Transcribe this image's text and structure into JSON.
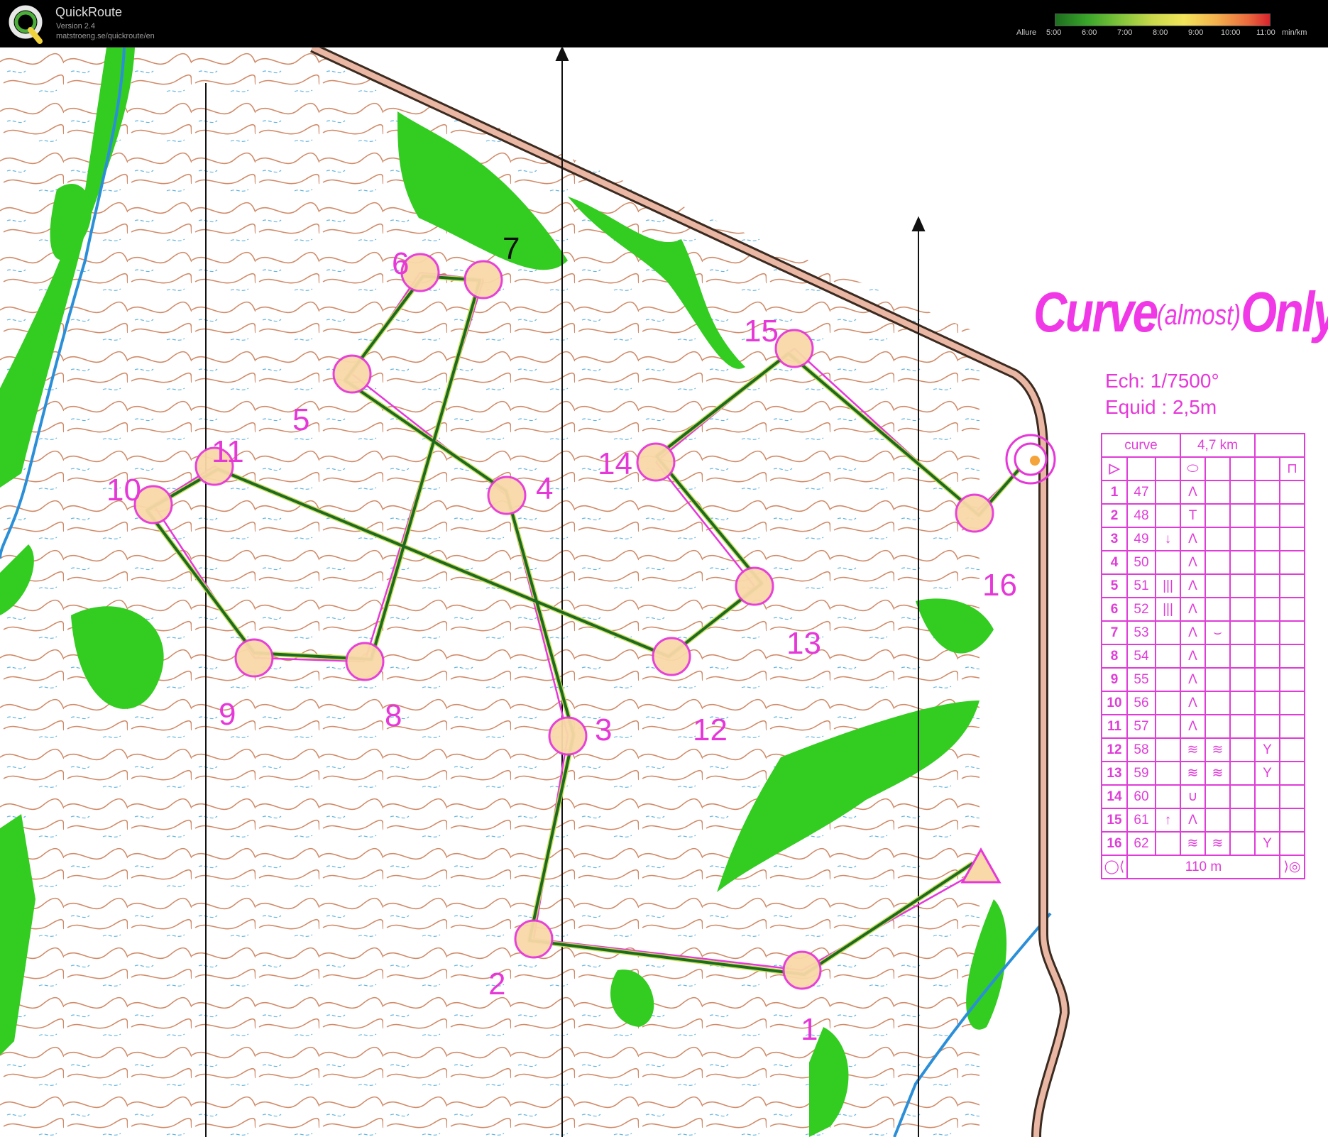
{
  "app": {
    "name": "QuickRoute",
    "version": "Version 2.4",
    "url": "matstroeng.se/quickroute/en"
  },
  "pace_scale": {
    "label": "Allure",
    "unit": "min/km",
    "ticks": [
      "5:00",
      "6:00",
      "7:00",
      "8:00",
      "9:00",
      "10:00",
      "11:00"
    ],
    "colors": [
      "#1d6e1f",
      "#3aa52a",
      "#7fc43a",
      "#c8d84a",
      "#f2e45a",
      "#f4b14d",
      "#ea6a3d",
      "#d8232c"
    ]
  },
  "map": {
    "title_main_1": "Curve",
    "title_small": "(almost)",
    "title_main_2": "Only",
    "scale_text": "Ech: 1/7500°",
    "equidistance_text": "Equid : 2,5m",
    "route_color": "#1f6a21",
    "course_color": "#e637d8",
    "controls": [
      {
        "label": "1"
      },
      {
        "label": "2"
      },
      {
        "label": "3"
      },
      {
        "label": "4"
      },
      {
        "label": "5"
      },
      {
        "label": "6"
      },
      {
        "label": "7"
      },
      {
        "label": "8"
      },
      {
        "label": "9"
      },
      {
        "label": "10"
      },
      {
        "label": "11"
      },
      {
        "label": "12"
      },
      {
        "label": "13"
      },
      {
        "label": "14"
      },
      {
        "label": "15"
      },
      {
        "label": "16"
      }
    ]
  },
  "description_sheet": {
    "class_name": "curve",
    "length": "4,7 km",
    "finish_distance": "110 m",
    "rows": [
      {
        "num": "1",
        "code": "47",
        "c": "",
        "d": "Λ",
        "e": "",
        "f": "",
        "g": ""
      },
      {
        "num": "2",
        "code": "48",
        "c": "",
        "d": "T",
        "e": "",
        "f": "",
        "g": ""
      },
      {
        "num": "3",
        "code": "49",
        "c": "↓",
        "d": "Λ",
        "e": "",
        "f": "",
        "g": ""
      },
      {
        "num": "4",
        "code": "50",
        "c": "",
        "d": "Λ",
        "e": "",
        "f": "",
        "g": ""
      },
      {
        "num": "5",
        "code": "51",
        "c": "|||",
        "d": "Λ",
        "e": "",
        "f": "",
        "g": ""
      },
      {
        "num": "6",
        "code": "52",
        "c": "|||",
        "d": "Λ",
        "e": "",
        "f": "",
        "g": ""
      },
      {
        "num": "7",
        "code": "53",
        "c": "",
        "d": "Λ",
        "e": "⌣",
        "f": "",
        "g": ""
      },
      {
        "num": "8",
        "code": "54",
        "c": "",
        "d": "Λ",
        "e": "",
        "f": "",
        "g": ""
      },
      {
        "num": "9",
        "code": "55",
        "c": "",
        "d": "Λ",
        "e": "",
        "f": "",
        "g": ""
      },
      {
        "num": "10",
        "code": "56",
        "c": "",
        "d": "Λ",
        "e": "",
        "f": "",
        "g": ""
      },
      {
        "num": "11",
        "code": "57",
        "c": "",
        "d": "Λ",
        "e": "",
        "f": "",
        "g": ""
      },
      {
        "num": "12",
        "code": "58",
        "c": "",
        "d": "≋",
        "e": "≋",
        "f": "",
        "g": "Y"
      },
      {
        "num": "13",
        "code": "59",
        "c": "",
        "d": "≋",
        "e": "≋",
        "f": "",
        "g": "Y"
      },
      {
        "num": "14",
        "code": "60",
        "c": "",
        "d": "∪",
        "e": "",
        "f": "",
        "g": ""
      },
      {
        "num": "15",
        "code": "61",
        "c": "↑",
        "d": "Λ",
        "e": "",
        "f": "",
        "g": ""
      },
      {
        "num": "16",
        "code": "62",
        "c": "",
        "d": "≋",
        "e": "≋",
        "f": "",
        "g": "Y"
      }
    ]
  }
}
